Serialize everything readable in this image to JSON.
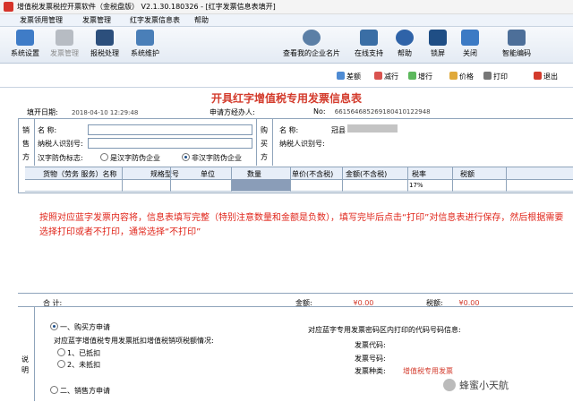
{
  "window": {
    "title": "增值税发票税控开票软件（金税盘版） V2.1.30.180326 - [红字发票信息表填开]"
  },
  "menu": [
    "发票领用管理",
    "发票管理",
    "红字发票信息表",
    "帮助"
  ],
  "toolbar": {
    "left": [
      {
        "label": "系统设置",
        "icon": "gear-icon",
        "enabled": true
      },
      {
        "label": "发票管理",
        "icon": "invoice-icon",
        "enabled": false
      },
      {
        "label": "报税处理",
        "icon": "monitor-icon",
        "enabled": true
      },
      {
        "label": "系统维护",
        "icon": "toolbox-icon",
        "enabled": true
      }
    ],
    "right": [
      {
        "label": "查看我的企业名片",
        "icon": "magnifier-icon"
      },
      {
        "label": "在线支持",
        "icon": "phone-icon"
      },
      {
        "label": "帮助",
        "icon": "help-icon"
      },
      {
        "label": "锁屏",
        "icon": "lock-screen-icon"
      },
      {
        "label": "关闭",
        "icon": "back-arrow-icon"
      },
      {
        "label": "智能编码",
        "icon": "code-icon"
      }
    ]
  },
  "secondary_toolbar": [
    "差额",
    "减行",
    "增行",
    "价格",
    "打印",
    "退出"
  ],
  "form": {
    "title": "开具红字增值税专用发票信息表",
    "fill_date_label": "填开日期:",
    "fill_date": "2018-04-10 12:29:48",
    "applicant_label": "申请方经办人:",
    "number_label": "No:",
    "number": "661564685269180410122948",
    "seller": {
      "side_label": "销售方",
      "name_label": "名 称:",
      "tax_id_label": "纳税人识别号:",
      "anti_fake_label": "汉字防伪标志:",
      "option_1": "是汉字防伪企业",
      "option_2": "非汉字防伪企业",
      "selected": 2
    },
    "buyer": {
      "side_label": "购买方",
      "name_label": "名 称:",
      "name_value": "冠县",
      "tax_id_label": "纳税人识别号:"
    },
    "columns": [
      "货物（劳务 服务）名称",
      "规格型号",
      "单位",
      "数量",
      "单价(不含税)",
      "金额(不含税)",
      "税率",
      "税额"
    ],
    "row": {
      "tax_rate": "17%"
    },
    "note": "按照对应蓝字发票内容将，信息表填写完整（特别注意数量和金额是负数），填写完毕后点击“打印”对信息表进行保存，然后根据需要选择打印或者不打印，通常选择“不打印”",
    "totals": {
      "label": "合 计:",
      "amount_label": "金额:",
      "amount": "¥0.00",
      "tax_label": "税额:",
      "tax": "¥0.00"
    },
    "explanation": {
      "label": "说明",
      "buyer_apply": "一、购买方申请",
      "question": "对应蓝字增值税专用发票抵扣增值税销项税额情况:",
      "opt1": "1、已抵扣",
      "opt2": "2、未抵扣",
      "seller_apply": "二、销售方申请",
      "right_title": "对应蓝字专用发票密码区内打印的代码号码信息:",
      "code_label": "发票代码:",
      "number_label": "发票号码:",
      "type_label": "发票种类:",
      "type_value": "增值税专用发票"
    }
  },
  "watermark": {
    "text": "蜂蜜小天航"
  },
  "colors": {
    "accent_red": "#d33b2c",
    "note_red": "#e0261b",
    "border_blue": "#8fa4bb"
  }
}
